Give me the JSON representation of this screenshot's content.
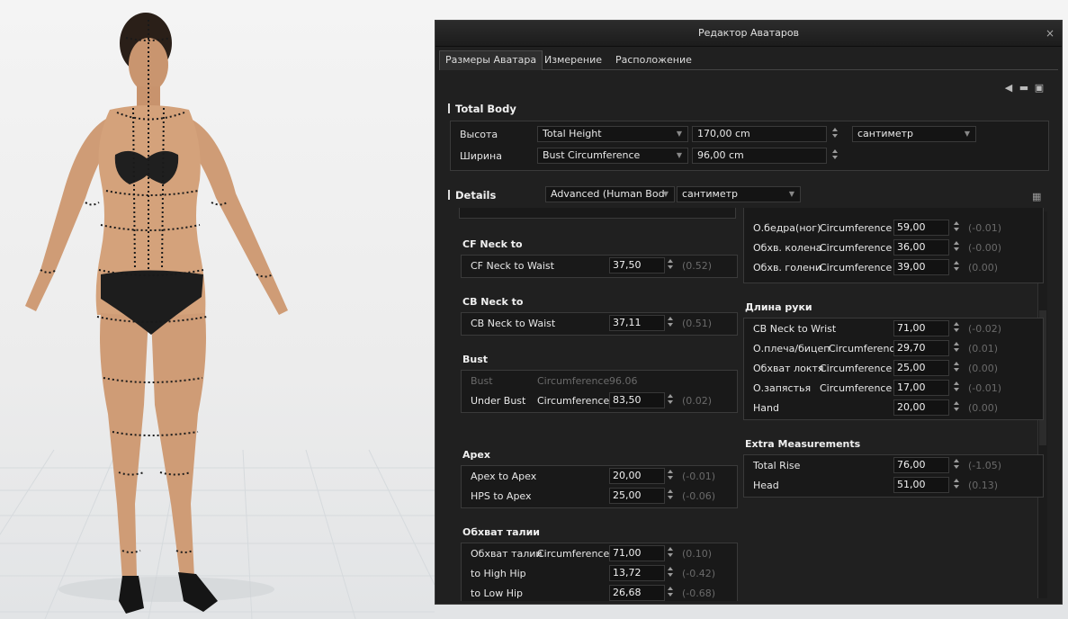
{
  "window": {
    "title": "Редактор Аватаров",
    "close_glyph": "×"
  },
  "tabs": [
    "Размеры Аватара",
    "Измерение",
    "Расположение"
  ],
  "toolbar_icons": [
    "undo-icon",
    "folder-icon",
    "save-icon"
  ],
  "total_body": {
    "title": "Total Body",
    "rows": [
      {
        "label": "Высота",
        "measure": "Total Height",
        "value": "170,00 cm",
        "unit": "сантиметр"
      },
      {
        "label": "Ширина",
        "measure": "Bust Circumference",
        "value": "96,00 cm"
      }
    ]
  },
  "details": {
    "title": "Details",
    "mode": "Advanced (Human Bod",
    "unit": "сантиметр",
    "left_groups": [
      {
        "title": "CF Neck to",
        "rows": [
          {
            "name": "CF Neck to Waist",
            "type": "",
            "value": "37,50",
            "delta": "(0.52)"
          }
        ]
      },
      {
        "title": "CB Neck to",
        "rows": [
          {
            "name": "CB Neck to Waist",
            "type": "",
            "value": "37,11",
            "delta": "(0.51)"
          }
        ]
      },
      {
        "title": "Bust",
        "rows": [
          {
            "name": "Bust",
            "type": "Circumference",
            "value": "96.06",
            "delta": "",
            "disabled": true
          },
          {
            "name": "Under Bust",
            "type": "Circumference",
            "value": "83,50",
            "delta": "(0.02)"
          }
        ]
      },
      {
        "title": "Apex",
        "rows": [
          {
            "name": "Apex to Apex",
            "type": "",
            "value": "20,00",
            "delta": "(-0.01)"
          },
          {
            "name": "HPS to Apex",
            "type": "",
            "value": "25,00",
            "delta": "(-0.06)"
          }
        ]
      },
      {
        "title": "Обхват талии",
        "rows": [
          {
            "name": "Обхват талии",
            "type": "Circumference",
            "value": "71,00",
            "delta": "(0.10)"
          },
          {
            "name": "to High Hip",
            "type": "",
            "value": "13,72",
            "delta": "(-0.42)"
          },
          {
            "name": "to Low Hip",
            "type": "",
            "value": "26,68",
            "delta": "(-0.68)"
          }
        ]
      }
    ],
    "right_top_rows": [
      {
        "name": "О.бедра(ног)",
        "type": "Circumference",
        "value": "59,00",
        "delta": "(-0.01)"
      },
      {
        "name": "Обхв. колена",
        "type": "Circumference",
        "value": "36,00",
        "delta": "(-0.00)"
      },
      {
        "name": "Обхв. голени",
        "type": "Circumference",
        "value": "39,00",
        "delta": "(0.00)"
      }
    ],
    "right_groups": [
      {
        "title": "Длина руки",
        "rows": [
          {
            "name": "CB Neck to Wrist",
            "type": "",
            "value": "71,00",
            "delta": "(-0.02)"
          },
          {
            "name": "О.плеча/бицеп",
            "type": "Circumference",
            "value": "29,70",
            "delta": "(0.01)"
          },
          {
            "name": "Обхват локтя",
            "type": "Circumference",
            "value": "25,00",
            "delta": "(0.00)"
          },
          {
            "name": "О.запястья",
            "type": "Circumference",
            "value": "17,00",
            "delta": "(-0.01)"
          },
          {
            "name": "Hand",
            "type": "",
            "value": "20,00",
            "delta": "(0.00)"
          }
        ]
      },
      {
        "title": "Extra Measurements",
        "rows": [
          {
            "name": "Total Rise",
            "type": "",
            "value": "76,00",
            "delta": "(-1.05)"
          },
          {
            "name": "Head",
            "type": "",
            "value": "51,00",
            "delta": "(0.13)"
          }
        ]
      }
    ]
  },
  "colors": {
    "panel_bg": "#202020",
    "viewport_bg": "#f0f0f0",
    "skin": "#d2a07a",
    "underwear": "#1c1c1c"
  }
}
